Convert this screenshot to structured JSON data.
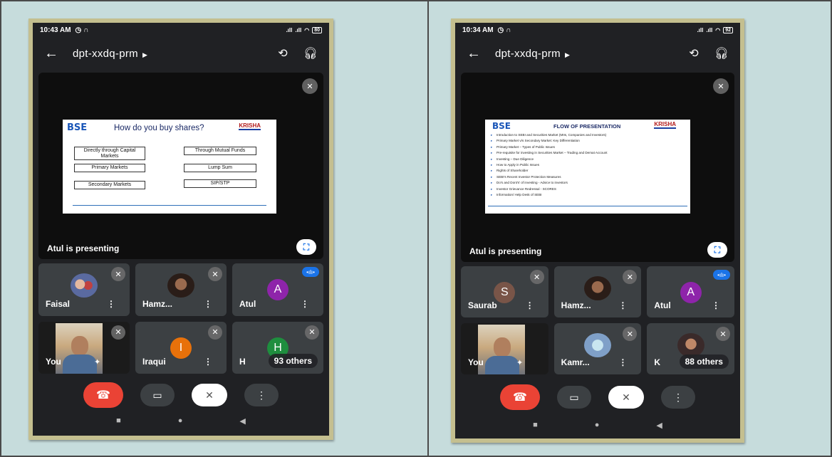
{
  "screens": [
    {
      "status": {
        "time": "10:43 AM",
        "battery": "80"
      },
      "meeting_code": "dpt-xxdq-prm",
      "presenting_label": "Atul is presenting",
      "slide": {
        "logo_left": "BSE",
        "logo_right": "KRISHA",
        "title": "How do you buy shares?",
        "boxes": [
          "Directly through Capital Markets",
          "Through Mutual Funds",
          "Primary Markets",
          "Lump Sum",
          "Secondary Markets",
          "SIP/STP"
        ]
      },
      "participants": [
        {
          "name": "Faisal"
        },
        {
          "name": "Hamz..."
        },
        {
          "name": "Atul",
          "initial": "A"
        },
        {
          "name": "You"
        },
        {
          "name": "Iraqui",
          "initial": "I"
        },
        {
          "name": "H",
          "initial": "H",
          "others": "93 others"
        }
      ]
    },
    {
      "status": {
        "time": "10:34 AM",
        "battery": "92"
      },
      "meeting_code": "dpt-xxdq-prm",
      "presenting_label": "Atul is presenting",
      "slide": {
        "logo_left": "BSE",
        "logo_right": "KRISHA",
        "title": "FLOW OF PRESENTATION",
        "items": [
          "Introduction to SEBI and Securities Market (MIIs, Companies and Investors)",
          "Primary Market v/s Secondary Market: Key Differentiation",
          "Primary Market – Types of Public Issues",
          "Pre-requisite for investing in Securities Market – Trading and Demat Account",
          "Investing – Due Diligence",
          "How to Apply in Public Issues",
          "Rights of Shareholder",
          "SEBI's Recent Investor Protection Measures",
          "Do's and Dont's' of investing - Advice to investors",
          "Investor Grievance Redressal - SCORES",
          "Information/ Help Desk of SEBI"
        ]
      },
      "participants": [
        {
          "name": "Saurab",
          "initial": "S"
        },
        {
          "name": "Hamz..."
        },
        {
          "name": "Atul",
          "initial": "A"
        },
        {
          "name": "You"
        },
        {
          "name": "Kamr..."
        },
        {
          "name": "K",
          "others": "88 others"
        }
      ]
    }
  ],
  "colors": {
    "end_call": "#ea4335",
    "avatar_atul": "#8e24aa",
    "avatar_saurab": "#795548",
    "avatar_iraqui": "#e8710a",
    "avatar_h": "#1e8e3e",
    "speaking": "#1a73e8"
  }
}
